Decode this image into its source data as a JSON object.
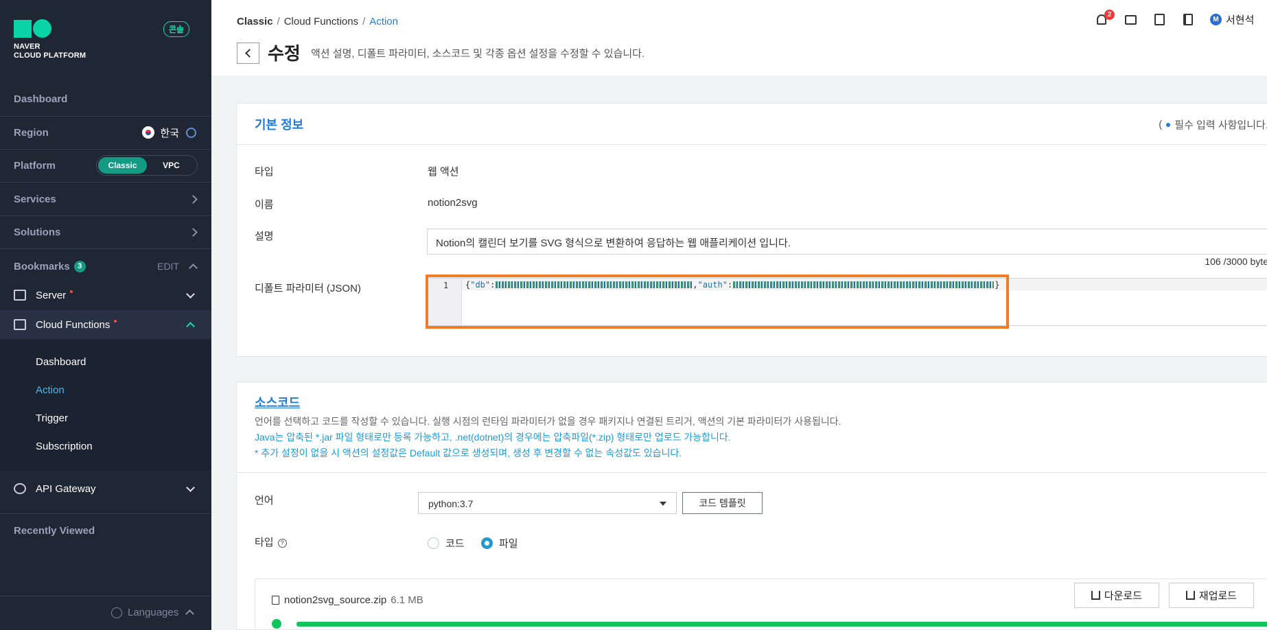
{
  "sidebar": {
    "console_badge": "콘솔",
    "logo_line1": "NAVER",
    "logo_line2": "CLOUD PLATFORM",
    "dashboard": "Dashboard",
    "region_label": "Region",
    "region_value": "한국",
    "platform_label": "Platform",
    "platform_options": [
      "Classic",
      "VPC"
    ],
    "platform_selected": "Classic",
    "services": "Services",
    "solutions": "Solutions",
    "bookmarks_label": "Bookmarks",
    "bookmarks_count": "3",
    "bookmarks_edit": "EDIT",
    "bookmark_items": [
      {
        "label": "Server",
        "icon": "server-icon",
        "new_dot": true
      },
      {
        "label": "Cloud Functions",
        "icon": "cloud-functions-icon",
        "new_dot": true,
        "expanded": true
      },
      {
        "label": "API Gateway",
        "icon": "api-gateway-icon",
        "new_dot": false
      }
    ],
    "cloud_functions_sub": [
      "Dashboard",
      "Action",
      "Trigger",
      "Subscription"
    ],
    "active_sub": "Action",
    "recently_viewed": "Recently Viewed",
    "languages": "Languages"
  },
  "header": {
    "breadcrumb": [
      "Classic",
      "Cloud Functions",
      "Action"
    ],
    "breadcrumb_sep": "/",
    "title": "수정",
    "description": "액션 설명, 디폴트 파라미터, 소스코드 및 각종 옵션 설정을 수정할 수 있습니다.",
    "notification_count": "2",
    "user_initial": "M",
    "user_name": "서현석"
  },
  "basic_info": {
    "title": "기본 정보",
    "required_note_open": "(",
    "required_note": "필수 입력 사항입니다.",
    "type_label": "타입",
    "type_value": "웹 액션",
    "name_label": "이름",
    "name_value": "notion2svg",
    "desc_label": "설명",
    "desc_value": "Notion의 캘린더 보기를 SVG 형식으로 변환하여 응답하는 웹 애플리케이션 입니다.",
    "desc_count": "106 /3000 byte",
    "param_label": "디폴트 파라미터 (JSON)",
    "param_line_no": "1",
    "param_open": "{",
    "param_key1": "\"db\"",
    "param_colon": ":",
    "param_comma": ",",
    "param_key2": "\"auth\"",
    "param_close": "}"
  },
  "source": {
    "title": "소스코드",
    "info1": "언어를 선택하고 코드를 작성할 수 있습니다. 실행 시점의 런타임 파라미터가 없을 경우 패키지나 연결된 트리거, 액션의 기본 파라미터가 사용됩니다.",
    "info2": "Java는 압축된 *.jar 파일 형태로만 등록 가능하고, .net(dotnet)의 경우에는 압축파일(*.zip) 형태로만 업로드 가능합니다.",
    "info3": "* 추가 설정이 없을 시 액션의 설정값은 Default 값으로 생성되며, 생성 후 변경할 수 없는 속성값도 있습니다.",
    "lang_label": "언어",
    "lang_value": "python:3.7",
    "template_button": "코드 템플릿",
    "type_label": "타입",
    "type_help": "?",
    "radio_code": "코드",
    "radio_file": "파일",
    "radio_selected": "파일",
    "file_name": "notion2svg_source.zip",
    "file_size": "6.1 MB",
    "download_button": "다운로드",
    "reupload_button": "재업로드",
    "upload_progress": 1.0
  },
  "colors": {
    "accent": "#1f7bd6",
    "highlight": "#f47b25",
    "sidebar_bg": "#1f2634",
    "progress": "#10c35a"
  }
}
